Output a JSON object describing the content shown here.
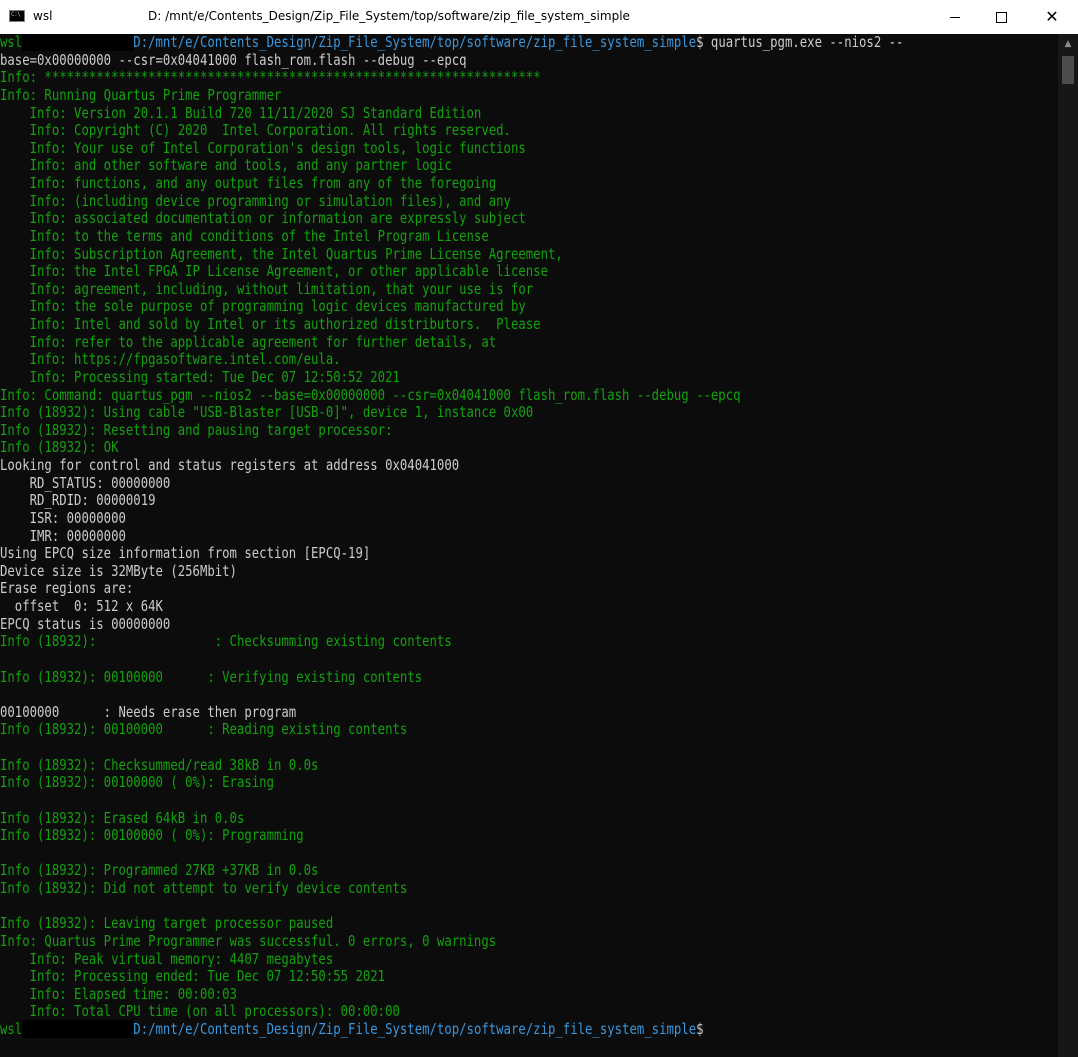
{
  "window": {
    "app_name": "wsl",
    "title": "D: /mnt/e/Contents_Design/Zip_File_System/top/software/zip_file_system_simple",
    "icon_text": "C:\\",
    "controls": {
      "minimize_icon": "minimize-icon",
      "maximize_icon": "maximize-icon",
      "close_icon": "close-icon",
      "close_glyph": "✕"
    }
  },
  "terminal": {
    "prompt_user": "wsl",
    "prompt_path": "D:/mnt/e/Contents_Design/Zip_File_System/top/software/zip_file_system_simple",
    "prompt_symbol": "$",
    "first_command": " quartus_pgm.exe --nios2 --",
    "first_command_cont": "base=0x00000000 --csr=0x04041000 flash_rom.flash --debug --epcq",
    "output": [
      {
        "text": "Info: *******************************************************************",
        "color": "g"
      },
      {
        "text": "Info: Running Quartus Prime Programmer",
        "color": "g"
      },
      {
        "text": "    Info: Version 20.1.1 Build 720 11/11/2020 SJ Standard Edition",
        "color": "g"
      },
      {
        "text": "    Info: Copyright (C) 2020  Intel Corporation. All rights reserved.",
        "color": "g"
      },
      {
        "text": "    Info: Your use of Intel Corporation's design tools, logic functions",
        "color": "g"
      },
      {
        "text": "    Info: and other software and tools, and any partner logic",
        "color": "g"
      },
      {
        "text": "    Info: functions, and any output files from any of the foregoing",
        "color": "g"
      },
      {
        "text": "    Info: (including device programming or simulation files), and any",
        "color": "g"
      },
      {
        "text": "    Info: associated documentation or information are expressly subject",
        "color": "g"
      },
      {
        "text": "    Info: to the terms and conditions of the Intel Program License",
        "color": "g"
      },
      {
        "text": "    Info: Subscription Agreement, the Intel Quartus Prime License Agreement,",
        "color": "g"
      },
      {
        "text": "    Info: the Intel FPGA IP License Agreement, or other applicable license",
        "color": "g"
      },
      {
        "text": "    Info: agreement, including, without limitation, that your use is for",
        "color": "g"
      },
      {
        "text": "    Info: the sole purpose of programming logic devices manufactured by",
        "color": "g"
      },
      {
        "text": "    Info: Intel and sold by Intel or its authorized distributors.  Please",
        "color": "g"
      },
      {
        "text": "    Info: refer to the applicable agreement for further details, at",
        "color": "g"
      },
      {
        "text": "    Info: https://fpgasoftware.intel.com/eula.",
        "color": "g"
      },
      {
        "text": "    Info: Processing started: Tue Dec 07 12:50:52 2021",
        "color": "g"
      },
      {
        "text": "Info: Command: quartus_pgm --nios2 --base=0x00000000 --csr=0x04041000 flash_rom.flash --debug --epcq",
        "color": "g"
      },
      {
        "text": "Info (18932): Using cable \"USB-Blaster [USB-0]\", device 1, instance 0x00",
        "color": "g"
      },
      {
        "text": "Info (18932): Resetting and pausing target processor:",
        "color": "g"
      },
      {
        "text": "Info (18932): OK",
        "color": "g"
      },
      {
        "text": "Looking for control and status registers at address 0x04041000",
        "color": "w"
      },
      {
        "text": "    RD_STATUS: 00000000",
        "color": "w"
      },
      {
        "text": "    RD_RDID: 00000019",
        "color": "w"
      },
      {
        "text": "    ISR: 00000000",
        "color": "w"
      },
      {
        "text": "    IMR: 00000000",
        "color": "w"
      },
      {
        "text": "Using EPCQ size information from section [EPCQ-19]",
        "color": "w"
      },
      {
        "text": "Device size is 32MByte (256Mbit)",
        "color": "w"
      },
      {
        "text": "Erase regions are:",
        "color": "w"
      },
      {
        "text": "  offset  0: 512 x 64K",
        "color": "w"
      },
      {
        "text": "EPCQ status is 00000000",
        "color": "w"
      },
      {
        "text": "Info (18932):                : Checksumming existing contents",
        "color": "g"
      },
      {
        "text": "",
        "color": "g"
      },
      {
        "text": "Info (18932): 00100000      : Verifying existing contents",
        "color": "g"
      },
      {
        "text": "",
        "color": "g"
      },
      {
        "text": "00100000      : Needs erase then program",
        "color": "w"
      },
      {
        "text": "Info (18932): 00100000      : Reading existing contents",
        "color": "g"
      },
      {
        "text": "",
        "color": "g"
      },
      {
        "text": "Info (18932): Checksummed/read 38kB in 0.0s",
        "color": "g"
      },
      {
        "text": "Info (18932): 00100000 ( 0%): Erasing",
        "color": "g"
      },
      {
        "text": "",
        "color": "g"
      },
      {
        "text": "Info (18932): Erased 64kB in 0.0s",
        "color": "g"
      },
      {
        "text": "Info (18932): 00100000 ( 0%): Programming",
        "color": "g"
      },
      {
        "text": "",
        "color": "g"
      },
      {
        "text": "Info (18932): Programmed 27KB +37KB in 0.0s",
        "color": "g"
      },
      {
        "text": "Info (18932): Did not attempt to verify device contents",
        "color": "g"
      },
      {
        "text": "",
        "color": "g"
      },
      {
        "text": "Info (18932): Leaving target processor paused",
        "color": "g"
      },
      {
        "text": "Info: Quartus Prime Programmer was successful. 0 errors, 0 warnings",
        "color": "g"
      },
      {
        "text": "    Info: Peak virtual memory: 4407 megabytes",
        "color": "g"
      },
      {
        "text": "    Info: Processing ended: Tue Dec 07 12:50:55 2021",
        "color": "g"
      },
      {
        "text": "    Info: Elapsed time: 00:00:03",
        "color": "g"
      },
      {
        "text": "    Info: Total CPU time (on all processors): 00:00:00",
        "color": "g"
      }
    ]
  },
  "scrollbar": {
    "up_glyph": "▲"
  },
  "colors": {
    "background": "#0c0c0c",
    "info_green": "#13a10e",
    "plain_text": "#cccccc",
    "path_blue": "#3a96dd"
  }
}
